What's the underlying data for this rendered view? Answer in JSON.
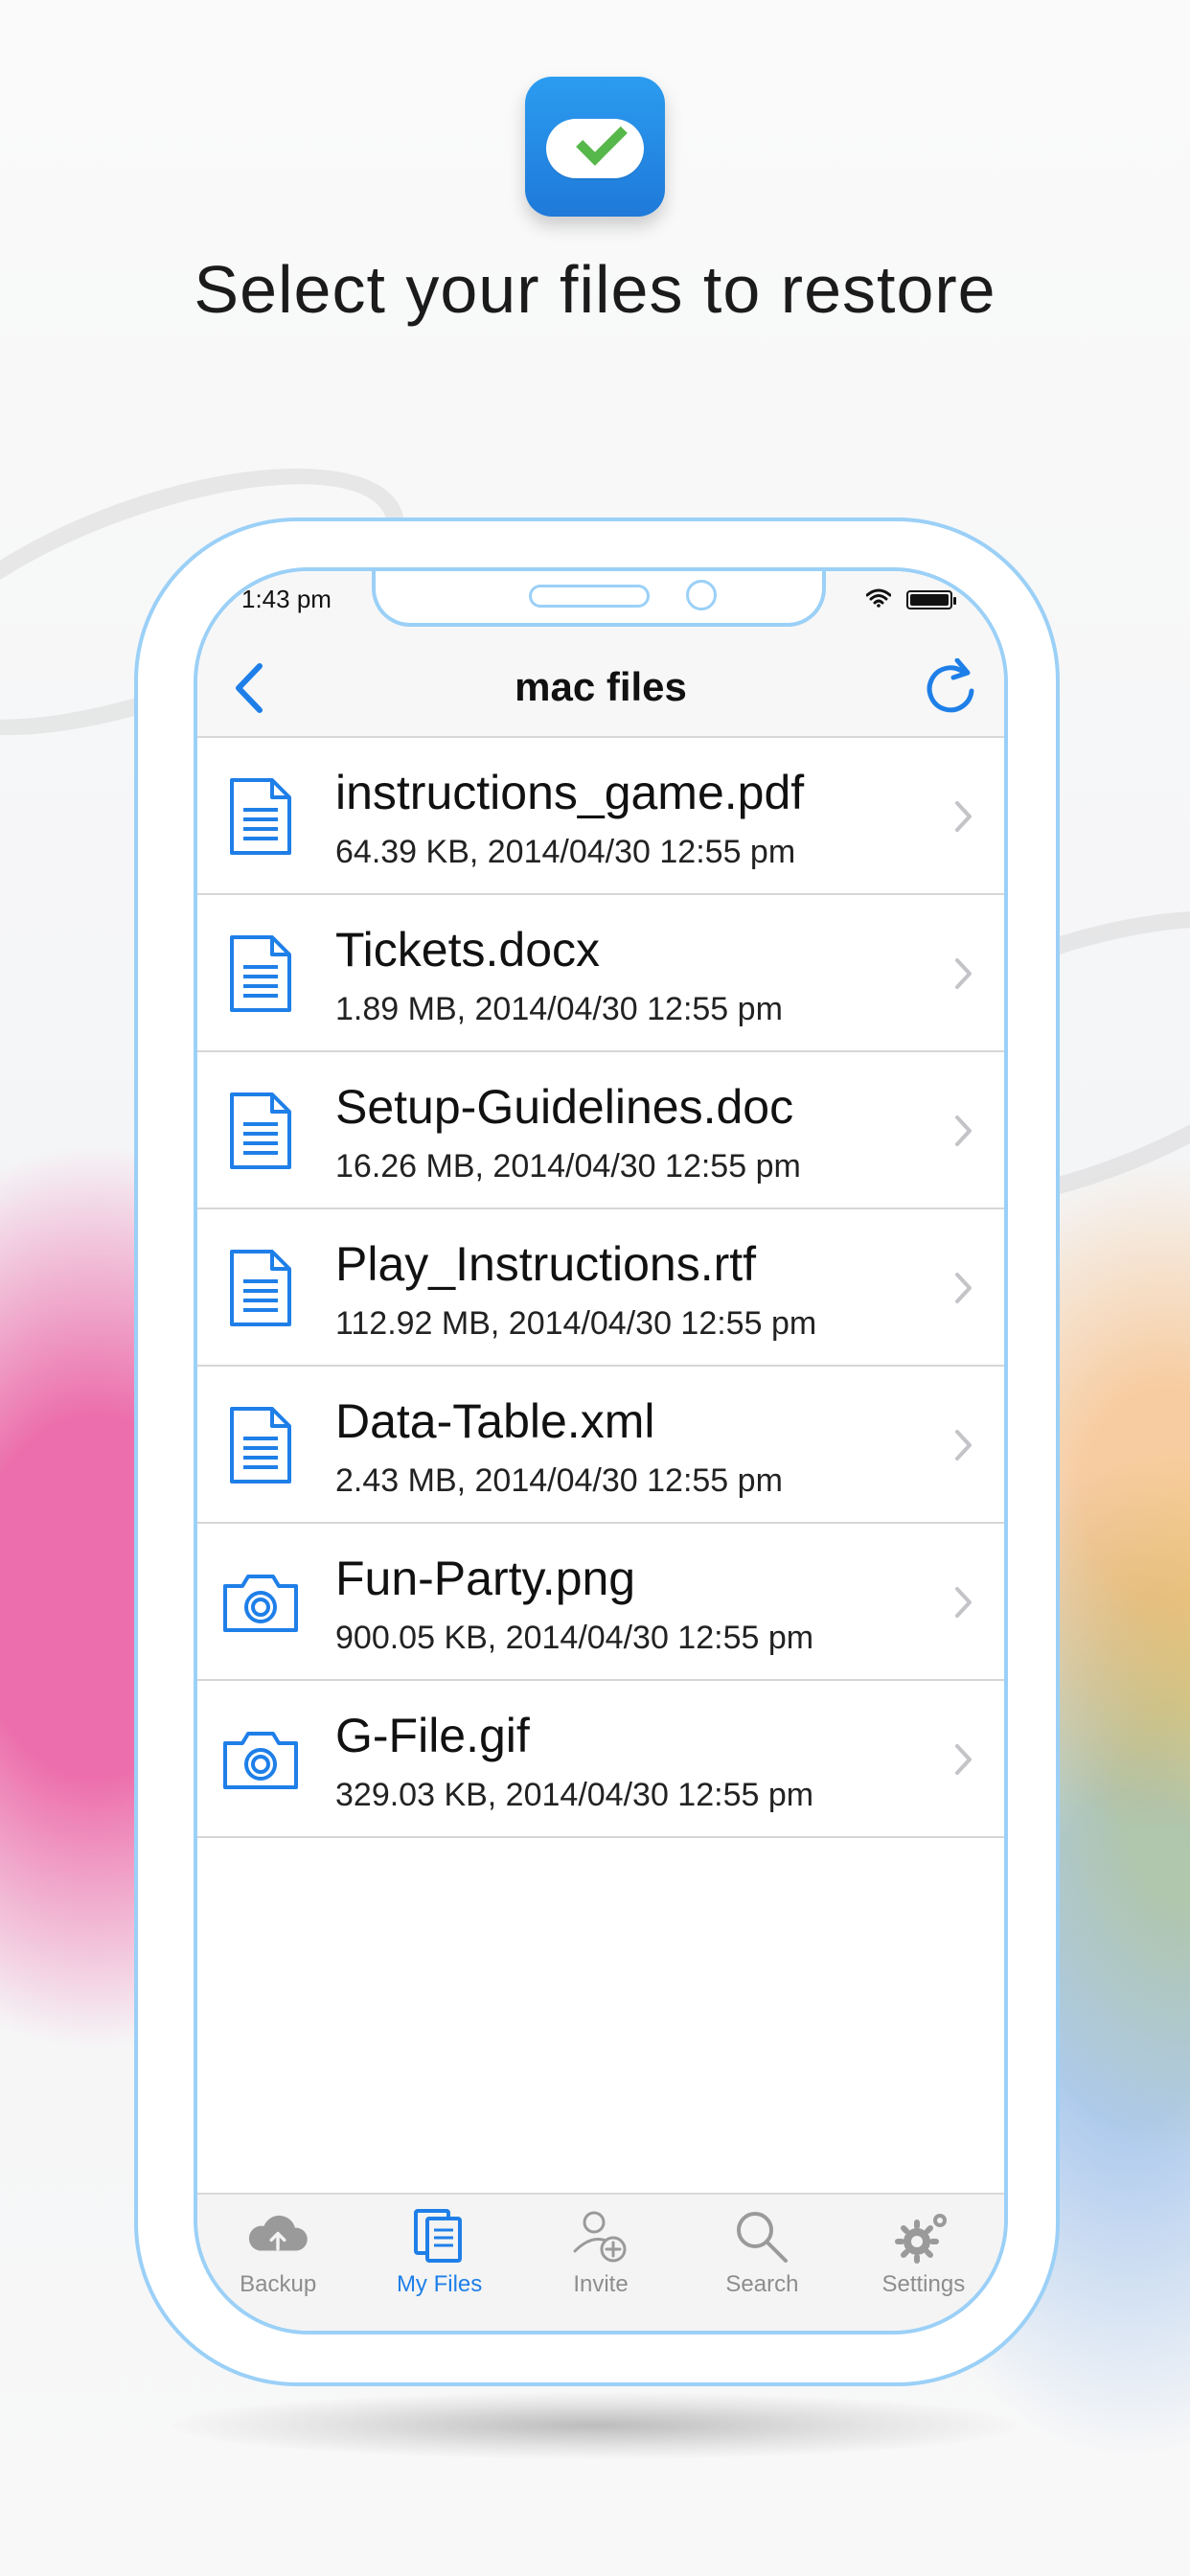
{
  "promo": {
    "headline": "Select your files to restore"
  },
  "status_bar": {
    "time": "1:43 pm"
  },
  "nav": {
    "title": "mac files"
  },
  "files": [
    {
      "name": "instructions_game.pdf",
      "meta": "64.39 KB, 2014/04/30 12:55 pm",
      "icon": "document-icon"
    },
    {
      "name": "Tickets.docx",
      "meta": "1.89 MB, 2014/04/30 12:55 pm",
      "icon": "document-icon"
    },
    {
      "name": "Setup-Guidelines.doc",
      "meta": "16.26 MB, 2014/04/30 12:55 pm",
      "icon": "document-icon"
    },
    {
      "name": "Play_Instructions.rtf",
      "meta": "112.92 MB, 2014/04/30 12:55 pm",
      "icon": "document-icon"
    },
    {
      "name": "Data-Table.xml",
      "meta": "2.43 MB, 2014/04/30 12:55 pm",
      "icon": "document-icon"
    },
    {
      "name": "Fun-Party.png",
      "meta": "900.05 KB, 2014/04/30 12:55 pm",
      "icon": "camera-icon"
    },
    {
      "name": "G-File.gif",
      "meta": "329.03 KB, 2014/04/30 12:55 pm",
      "icon": "camera-icon"
    }
  ],
  "tabs": [
    {
      "label": "Backup",
      "icon": "cloud-upload-icon",
      "active": false
    },
    {
      "label": "My Files",
      "icon": "files-icon",
      "active": true
    },
    {
      "label": "Invite",
      "icon": "add-user-icon",
      "active": false
    },
    {
      "label": "Search",
      "icon": "search-icon",
      "active": false
    },
    {
      "label": "Settings",
      "icon": "gear-icon",
      "active": false
    }
  ],
  "colors": {
    "accent": "#1f7fe8",
    "inactive_tab": "#8d8d8d",
    "phone_outline": "#9bd0f7",
    "check_green": "#56b84a"
  }
}
